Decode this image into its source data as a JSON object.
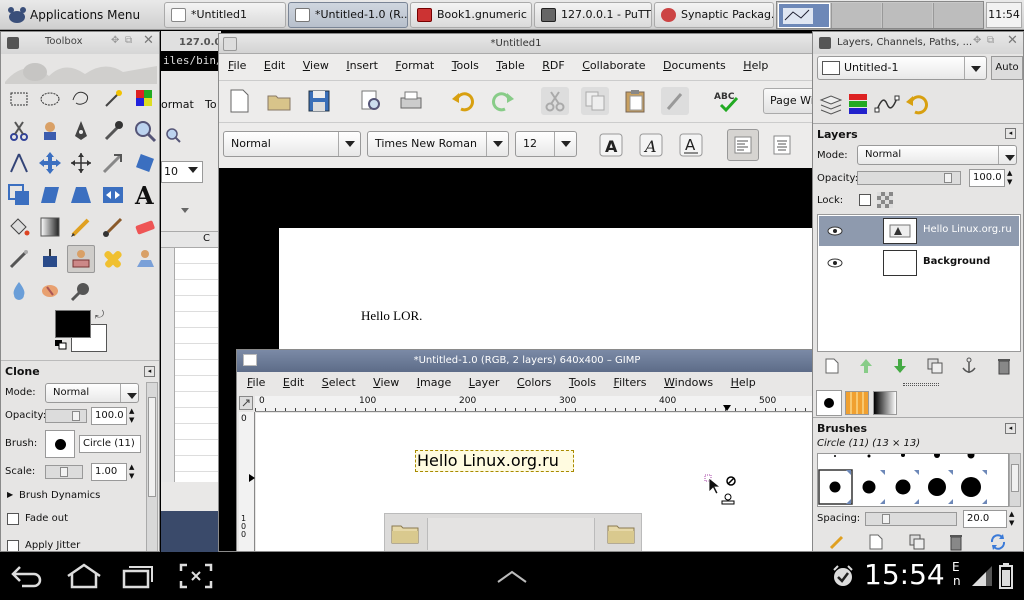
{
  "taskbar": {
    "apps_menu": "Applications Menu",
    "tasks": [
      {
        "label": "*Untitled1",
        "active": false
      },
      {
        "label": "*Untitled-1.0 (R...",
        "active": true
      },
      {
        "label": "Book1.gnumeric ...",
        "active": false
      },
      {
        "label": "127.0.0.1 - PuTTY",
        "active": false
      },
      {
        "label": "Synaptic Packag...",
        "active": false
      }
    ],
    "clock": "11:54"
  },
  "toolbox": {
    "title": "Toolbox",
    "tool_options": {
      "title": "Clone",
      "mode_label": "Mode:",
      "mode_value": "Normal",
      "opacity_label": "Opacity:",
      "opacity_value": "100.0",
      "brush_label": "Brush:",
      "brush_value": "Circle (11)",
      "scale_label": "Scale:",
      "scale_value": "1.00",
      "brush_dynamics": "Brush Dynamics",
      "fade_out": "Fade out",
      "apply_jitter": "Apply Jitter"
    }
  },
  "background_windows": {
    "putty_label": "127.0.0",
    "putty_path": "iles/bin/",
    "gnumeric_menu_format": "ormat",
    "gnumeric_menu_tools": "To",
    "gnumeric_font_size": "10",
    "gnumeric_col_c": "C",
    "gnumeric_bottom": "Pa"
  },
  "writer": {
    "title": "*Untitled1",
    "menu": [
      "File",
      "Edit",
      "View",
      "Insert",
      "Format",
      "Tools",
      "Table",
      "RDF",
      "Collaborate",
      "Documents",
      "Help"
    ],
    "page_width_btn": "Page Wid",
    "style": "Normal",
    "font": "Times New Roman",
    "size": "12",
    "doc_text": "Hello LOR."
  },
  "gimp_image": {
    "title": "*Untitled-1.0 (RGB, 2 layers) 640x400 – GIMP",
    "menu": [
      "File",
      "Edit",
      "Select",
      "View",
      "Image",
      "Layer",
      "Colors",
      "Tools",
      "Filters",
      "Windows",
      "Help"
    ],
    "ruler_ticks": [
      "0",
      "100",
      "200",
      "300",
      "400",
      "500"
    ],
    "vruler_top": "0",
    "vruler_bottom": "100",
    "canvas_text": "Hello Linux.org.ru"
  },
  "layers_dock": {
    "title": "Layers, Channels, Paths, ...",
    "image_select": "Untitled-1",
    "auto_btn": "Auto",
    "layers_title": "Layers",
    "mode_label": "Mode:",
    "mode_value": "Normal",
    "opacity_label": "Opacity:",
    "opacity_value": "100.0",
    "lock_label": "Lock:",
    "layers": [
      {
        "name": "Hello Linux.org.ru",
        "selected": true
      },
      {
        "name": "Background",
        "selected": false
      }
    ],
    "brushes_title": "Brushes",
    "brush_info": "Circle (11) (13 × 13)",
    "spacing_label": "Spacing:",
    "spacing_value": "20.0"
  },
  "statusbar": {
    "time": "15:54",
    "lang_top": "E",
    "lang_bottom": "n"
  },
  "colors": {
    "accent": "#6d88b8",
    "selected_layer": "#8e9aae"
  }
}
